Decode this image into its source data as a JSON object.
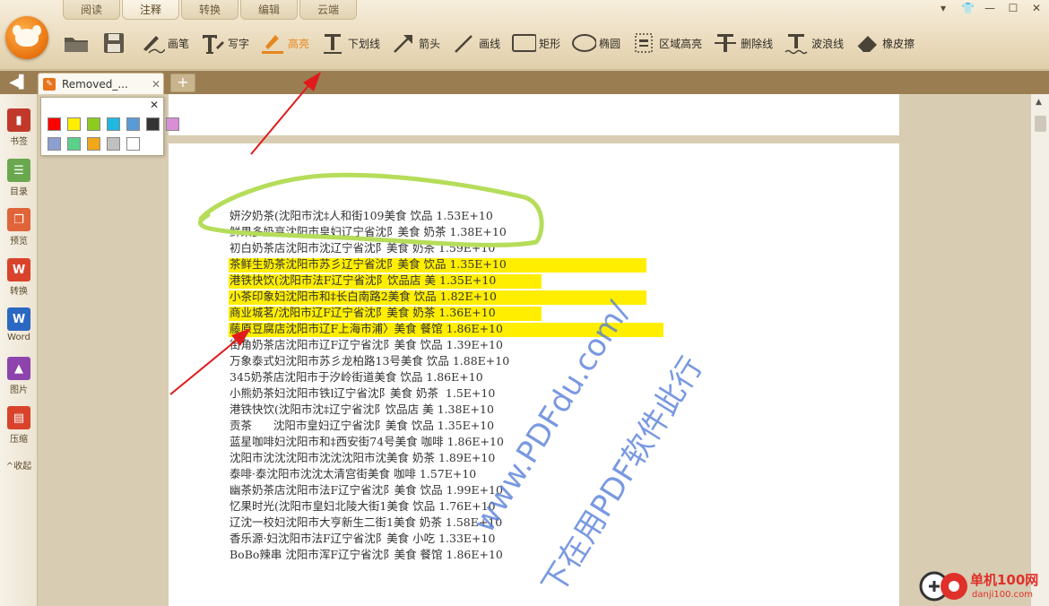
{
  "menu_tabs": [
    "阅读",
    "注释",
    "转换",
    "编辑",
    "云端"
  ],
  "toolbar": {
    "open_label": "",
    "save_label": "",
    "pen_label": "画笔",
    "typewriter_label": "写字",
    "highlight_label": "高亮",
    "underline_label": "下划线",
    "arrow_label": "箭头",
    "line_label": "画线",
    "rect_label": "矩形",
    "ellipse_label": "椭圆",
    "area_highlight_label": "区域高亮",
    "strikeout_label": "删除线",
    "wavy_label": "波浪线",
    "eraser_label": "橡皮擦"
  },
  "tab": {
    "name": "Removed_...",
    "close": "✕",
    "new": "+"
  },
  "sidebar": {
    "items": [
      {
        "label": "书签",
        "icon": "bookmark-icon",
        "color": "#c0392b"
      },
      {
        "label": "目录",
        "icon": "toc-icon",
        "color": "#6aa84f"
      },
      {
        "label": "预览",
        "icon": "preview-icon",
        "color": "#e0643a"
      },
      {
        "label": "转换",
        "icon": "convert-icon",
        "color": "#d9432c"
      },
      {
        "label": "Word",
        "icon": "word-icon",
        "color": "#2b68c2"
      },
      {
        "label": "图片",
        "icon": "image-icon",
        "color": "#8e44ad"
      },
      {
        "label": "压缩",
        "icon": "compress-icon",
        "color": "#d9432c"
      }
    ],
    "collapse_label": "^收起"
  },
  "palette": {
    "close": "✕",
    "colors": [
      "#ff0000",
      "#ffee00",
      "#8ccc1f",
      "#1fb8e0",
      "#5a9bd5",
      "#333333",
      "#d88fd6",
      "#8d9ed0",
      "#5bd08a",
      "#f0a819",
      "#c0c0c0",
      "#ffffff"
    ]
  },
  "document": {
    "rows": [
      "妍汐奶茶(沈阳市沈‡人和街109美食 饮品 1.53E+10",
      "鲜果多奶亨沈阳市皇妇辽宁省沈阝美食 奶茶 1.38E+10",
      "初白奶茶店沈阳市沈辽宁省沈阝美食 奶茶 1.59E+10",
      "茶鲜生奶茶沈阳市苏彡辽宁省沈阝美食 饮品 1.35E+10",
      "港铁快饮(沈阳市法F辽宁省沈阝饮品店 美 1.35E+10",
      "小茶印象妇沈阳市和‡长白南路2美食 饮品 1.82E+10",
      "商业城茗/沈阳市辽F辽宁省沈阝美食 奶茶 1.36E+10",
      "藤原豆腐店沈阳市辽F上海市浦〉美食 餐馆 1.86E+10",
      "街角奶茶店沈阳市辽F辽宁省沈阝美食 饮品 1.39E+10",
      "万象泰式妇沈阳市苏彡龙柏路13号美食 饮品 1.88E+10",
      "345奶茶店沈阳市于汐岭街道美食 饮品 1.86E+10",
      "小熊奶茶妇沈阳市铁l辽宁省沈阝美食 奶茶  1.5E+10",
      "港铁快饮(沈阳市沈‡辽宁省沈阝饮品店 美 1.38E+10",
      "贡茶      沈阳市皇妇辽宁省沈阝美食 饮品 1.35E+10",
      "蓝星咖啡妇沈阳市和‡西安街74号美食 咖啡 1.86E+10",
      "沈阳市沈沈沈阳市沈沈沈阳市沈美食 奶茶 1.89E+10",
      "泰啡·泰沈阳市沈沈太清宫街美食 咖啡 1.57E+10",
      "幽茶奶茶店沈阳市法F辽宁省沈阝美食 饮品 1.99E+10",
      "忆果时光(沈阳市皇妇北陵大街1美食 饮品 1.76E+10",
      "辽沈一校妇沈阳市大亨新生二街1美食 奶茶 1.58E+10",
      "香乐源·妇沈阳市法F辽宁省沈阝美食 小吃 1.33E+10",
      "BoBo辣串 沈阳市浑F辽宁省沈阝美食 餐馆 1.86E+10"
    ],
    "highlighted_rows": [
      3,
      4,
      5,
      6,
      7
    ]
  },
  "watermark": {
    "line1": "www.PDFdu.com/",
    "line2": "下在用PDF软件此行"
  },
  "corner_brand": {
    "name": "单机100网",
    "url": "danji100.com"
  },
  "colors": {
    "highlight": "#ffee00",
    "active_tool": "#e7861f",
    "circle_annotation": "#b5dd5a",
    "arrow": "#e01b1b"
  }
}
